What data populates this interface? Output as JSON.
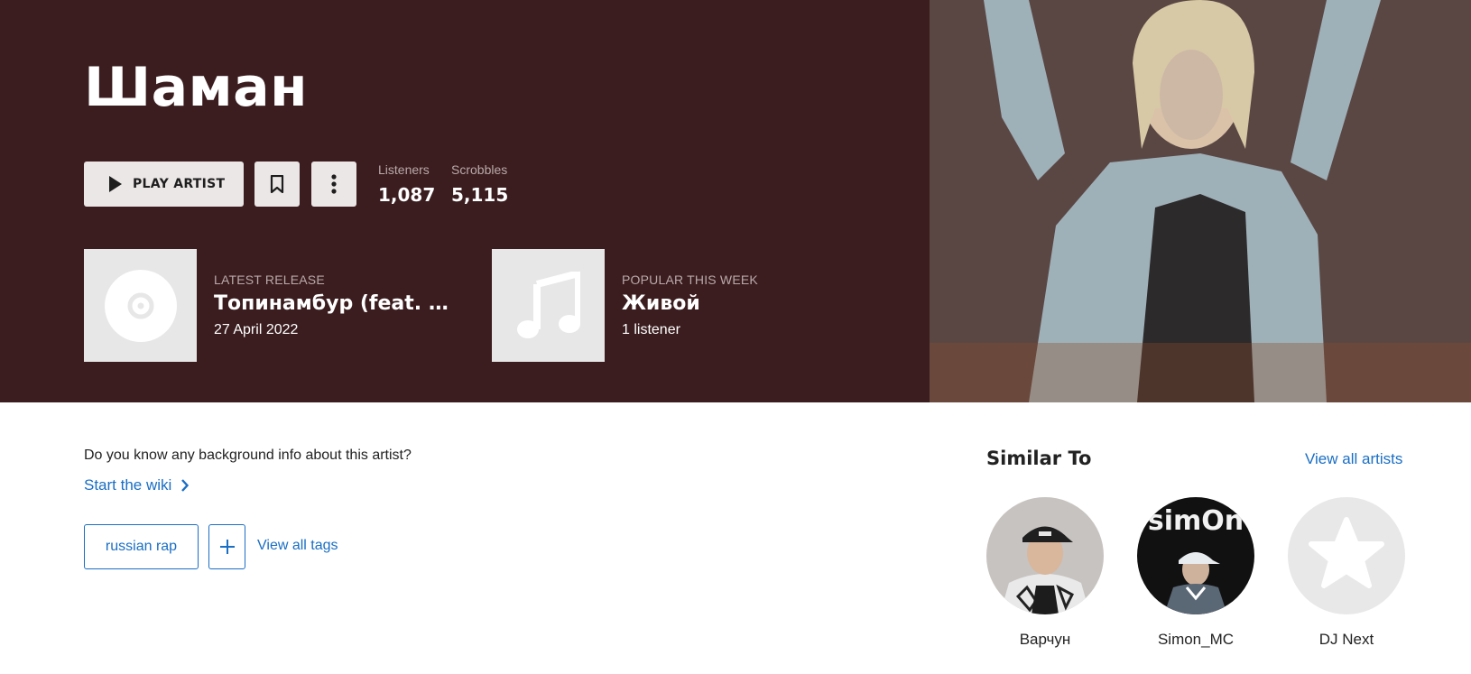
{
  "artist": {
    "name": "Шаман",
    "play_label": "PLAY ARTIST",
    "stats": [
      {
        "label": "Listeners",
        "value": "1,087"
      },
      {
        "label": "Scrobbles",
        "value": "5,115"
      }
    ]
  },
  "latest_release": {
    "kicker": "LATEST RELEASE",
    "title": "Топинамбур (feat. Бу...",
    "date": "27 April 2022"
  },
  "popular": {
    "kicker": "POPULAR THIS WEEK",
    "title": "Живой",
    "listeners": "1 listener"
  },
  "wiki": {
    "question": "Do you know any background info about this artist?",
    "link": "Start the wiki"
  },
  "tags": {
    "items": [
      "russian rap"
    ],
    "view_all": "View all tags"
  },
  "similar": {
    "title": "Similar To",
    "view_all": "View all artists",
    "artists": [
      {
        "name": "Варчун"
      },
      {
        "name": "Simon_MC",
        "avatar_text": "simOn"
      },
      {
        "name": "DJ Next"
      }
    ]
  },
  "colors": {
    "header_bg": "#3b1d1f",
    "link": "#1a6ec4",
    "button_bg": "#ebe7e6"
  }
}
